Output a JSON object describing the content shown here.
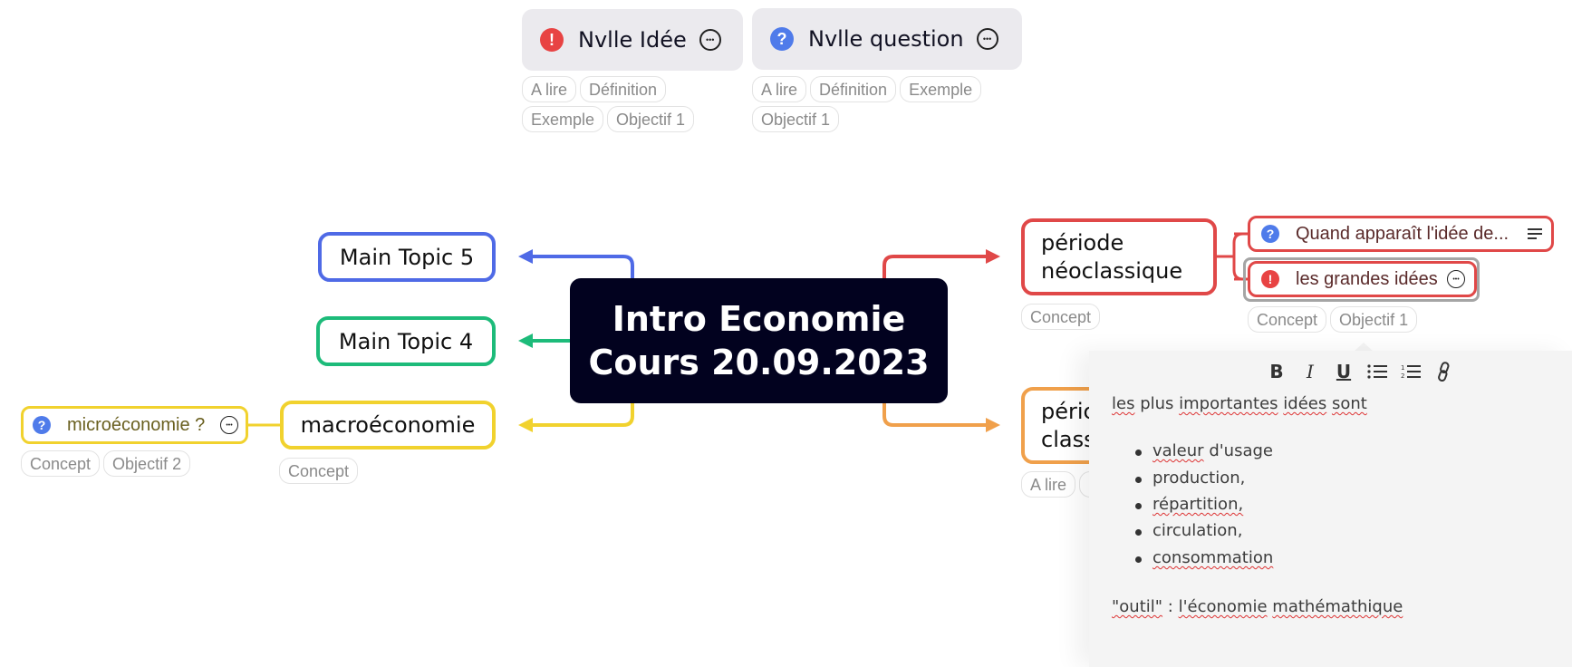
{
  "top_nodes": [
    {
      "label": "Nvlle Idée",
      "icon": "exclamation-icon",
      "tags": [
        "A lire",
        "Définition",
        "Exemple",
        "Objectif 1"
      ]
    },
    {
      "label": "Nvlle question",
      "icon": "question-icon",
      "tags": [
        "A lire",
        "Définition",
        "Exemple",
        "Objectif 1"
      ]
    }
  ],
  "central": {
    "line1": "Intro Economie",
    "line2": "Cours 20.09.2023",
    "color": "#02021f"
  },
  "left_topics": [
    {
      "label": "Main Topic 5",
      "color": "#4f6ae6"
    },
    {
      "label": "Main Topic 4",
      "color": "#1dbb7a"
    },
    {
      "label": "macroéconomie",
      "color": "#f1d22e",
      "tags": [
        "Concept"
      ]
    }
  ],
  "micro": {
    "label": "microéconomie ?",
    "icon": "question-icon",
    "tags": [
      "Concept",
      "Objectif 2"
    ],
    "color": "#f1d22e"
  },
  "right_topics": [
    {
      "line1": "période",
      "line2": "néoclassique",
      "color": "#e04848",
      "tags": [
        "Concept"
      ]
    },
    {
      "line1": "péric",
      "line2": "class",
      "color": "#f0a04b",
      "tags": [
        "A lire"
      ]
    }
  ],
  "subtopics": [
    {
      "label": "Quand apparaît l'idée de...",
      "icon": "question-icon",
      "trail": "notes-icon"
    },
    {
      "label": "les grandes idées",
      "icon": "exclamation-icon",
      "trail": "more-icon",
      "tags": [
        "Concept",
        "Objectif 1"
      ],
      "selected": true
    }
  ],
  "notes": {
    "toolbar": [
      "B",
      "I",
      "U",
      "bulleted-list",
      "numbered-list",
      "link"
    ],
    "intro": "les plus importantes idées sont",
    "bullets": [
      "valeur d'usage",
      "production,",
      "répartition,",
      "circulation,",
      "consommation"
    ],
    "footer": "\"outil\" : l'économie mathémathique"
  }
}
